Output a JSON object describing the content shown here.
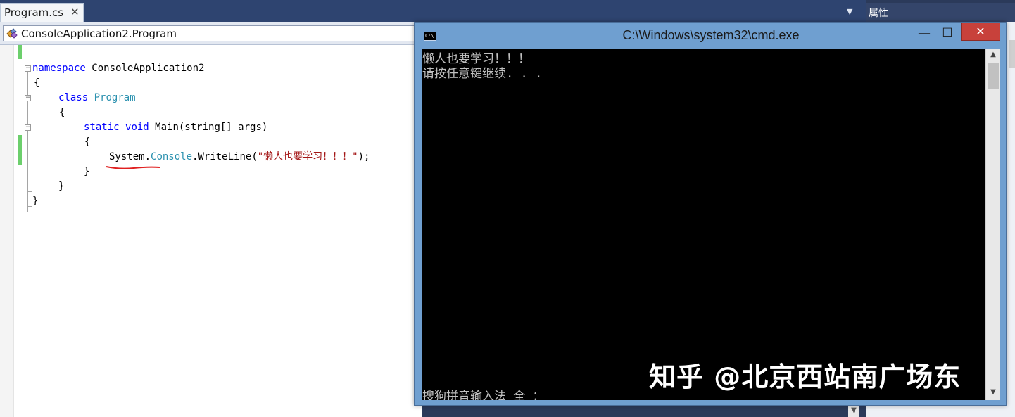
{
  "tab": {
    "label": "Program.cs",
    "close": "✕"
  },
  "nav": {
    "class_path": "ConsoleApplication2.Program"
  },
  "properties": {
    "title": "属性"
  },
  "code": {
    "line1_kw": "namespace",
    "line1_name": " ConsoleApplication2",
    "line2": "{",
    "line3_kw": "class",
    "line3_type": "Program",
    "line4": "{",
    "line5_kw1": "static",
    "line5_kw2": "void",
    "line5_rest": " Main(string[] args)",
    "line6": "{",
    "line7_a": "System.",
    "line7_type": "Console",
    "line7_b": ".WriteLine(",
    "line7_str": "\"懒人也要学习！！！\"",
    "line7_c": ");",
    "line8": "}",
    "line9": "}",
    "line10": "}"
  },
  "cmd": {
    "title": "C:\\Windows\\system32\\cmd.exe",
    "icon_text": "C:\\",
    "minimize": "—",
    "maximize": "☐",
    "close": "✕",
    "output_line1": "懒人也要学习！！！",
    "output_line2": "请按任意键继续. . .",
    "ime_status": "搜狗拼音输入法 全 ："
  },
  "watermark": "知乎 @北京西站南广场东",
  "colors": {
    "keyword": "#0000ff",
    "type": "#2b91af",
    "string": "#a31515",
    "squiggle": "#e02020"
  }
}
